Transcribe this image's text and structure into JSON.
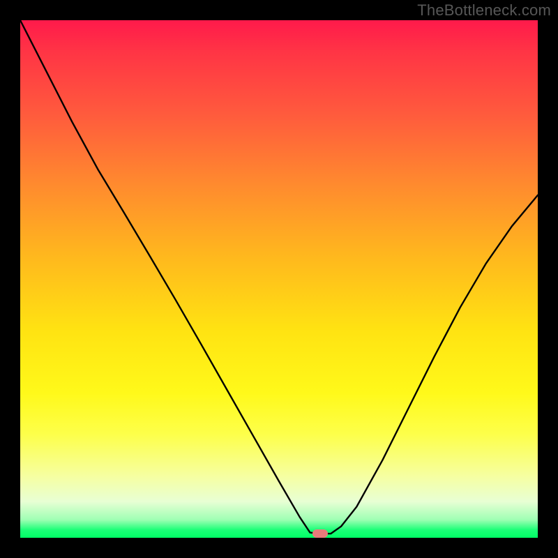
{
  "watermark": "TheBottleneck.com",
  "plot": {
    "inner_left": 29,
    "inner_top": 29,
    "inner_width": 742,
    "inner_height": 742
  },
  "marker": {
    "x_frac": 0.58,
    "y_frac": 0.992,
    "color": "#e77b7a"
  },
  "chart_data": {
    "type": "line",
    "title": "",
    "xlabel": "",
    "ylabel": "",
    "xlim": [
      0,
      1
    ],
    "ylim": [
      0,
      1
    ],
    "note": "Axes unlabeled; values are normalized fractions of the plot area. x is horizontal position (0=left,1=right); y is vertical position (0=top,1=bottom). Curve dips to a flat minimum near x≈0.56–0.60 at y≈0.99 then rises again.",
    "series": [
      {
        "name": "bottleneck-curve",
        "x": [
          0.0,
          0.05,
          0.1,
          0.15,
          0.2,
          0.25,
          0.3,
          0.35,
          0.4,
          0.45,
          0.5,
          0.54,
          0.56,
          0.58,
          0.6,
          0.62,
          0.65,
          0.7,
          0.75,
          0.8,
          0.85,
          0.9,
          0.95,
          1.0
        ],
        "y": [
          0.0,
          0.098,
          0.196,
          0.288,
          0.371,
          0.455,
          0.54,
          0.627,
          0.715,
          0.803,
          0.891,
          0.96,
          0.99,
          0.992,
          0.992,
          0.978,
          0.94,
          0.85,
          0.75,
          0.65,
          0.555,
          0.47,
          0.398,
          0.338
        ]
      }
    ],
    "marker_point": {
      "x": 0.58,
      "y": 0.992
    },
    "background_gradient": {
      "direction": "top-to-bottom",
      "stops": [
        {
          "pos": 0.0,
          "color": "#ff1a4b"
        },
        {
          "pos": 0.18,
          "color": "#ff5a3d"
        },
        {
          "pos": 0.46,
          "color": "#ffb91d"
        },
        {
          "pos": 0.72,
          "color": "#fff91a"
        },
        {
          "pos": 0.93,
          "color": "#e8ffd4"
        },
        {
          "pos": 1.0,
          "color": "#00ff66"
        }
      ]
    }
  }
}
